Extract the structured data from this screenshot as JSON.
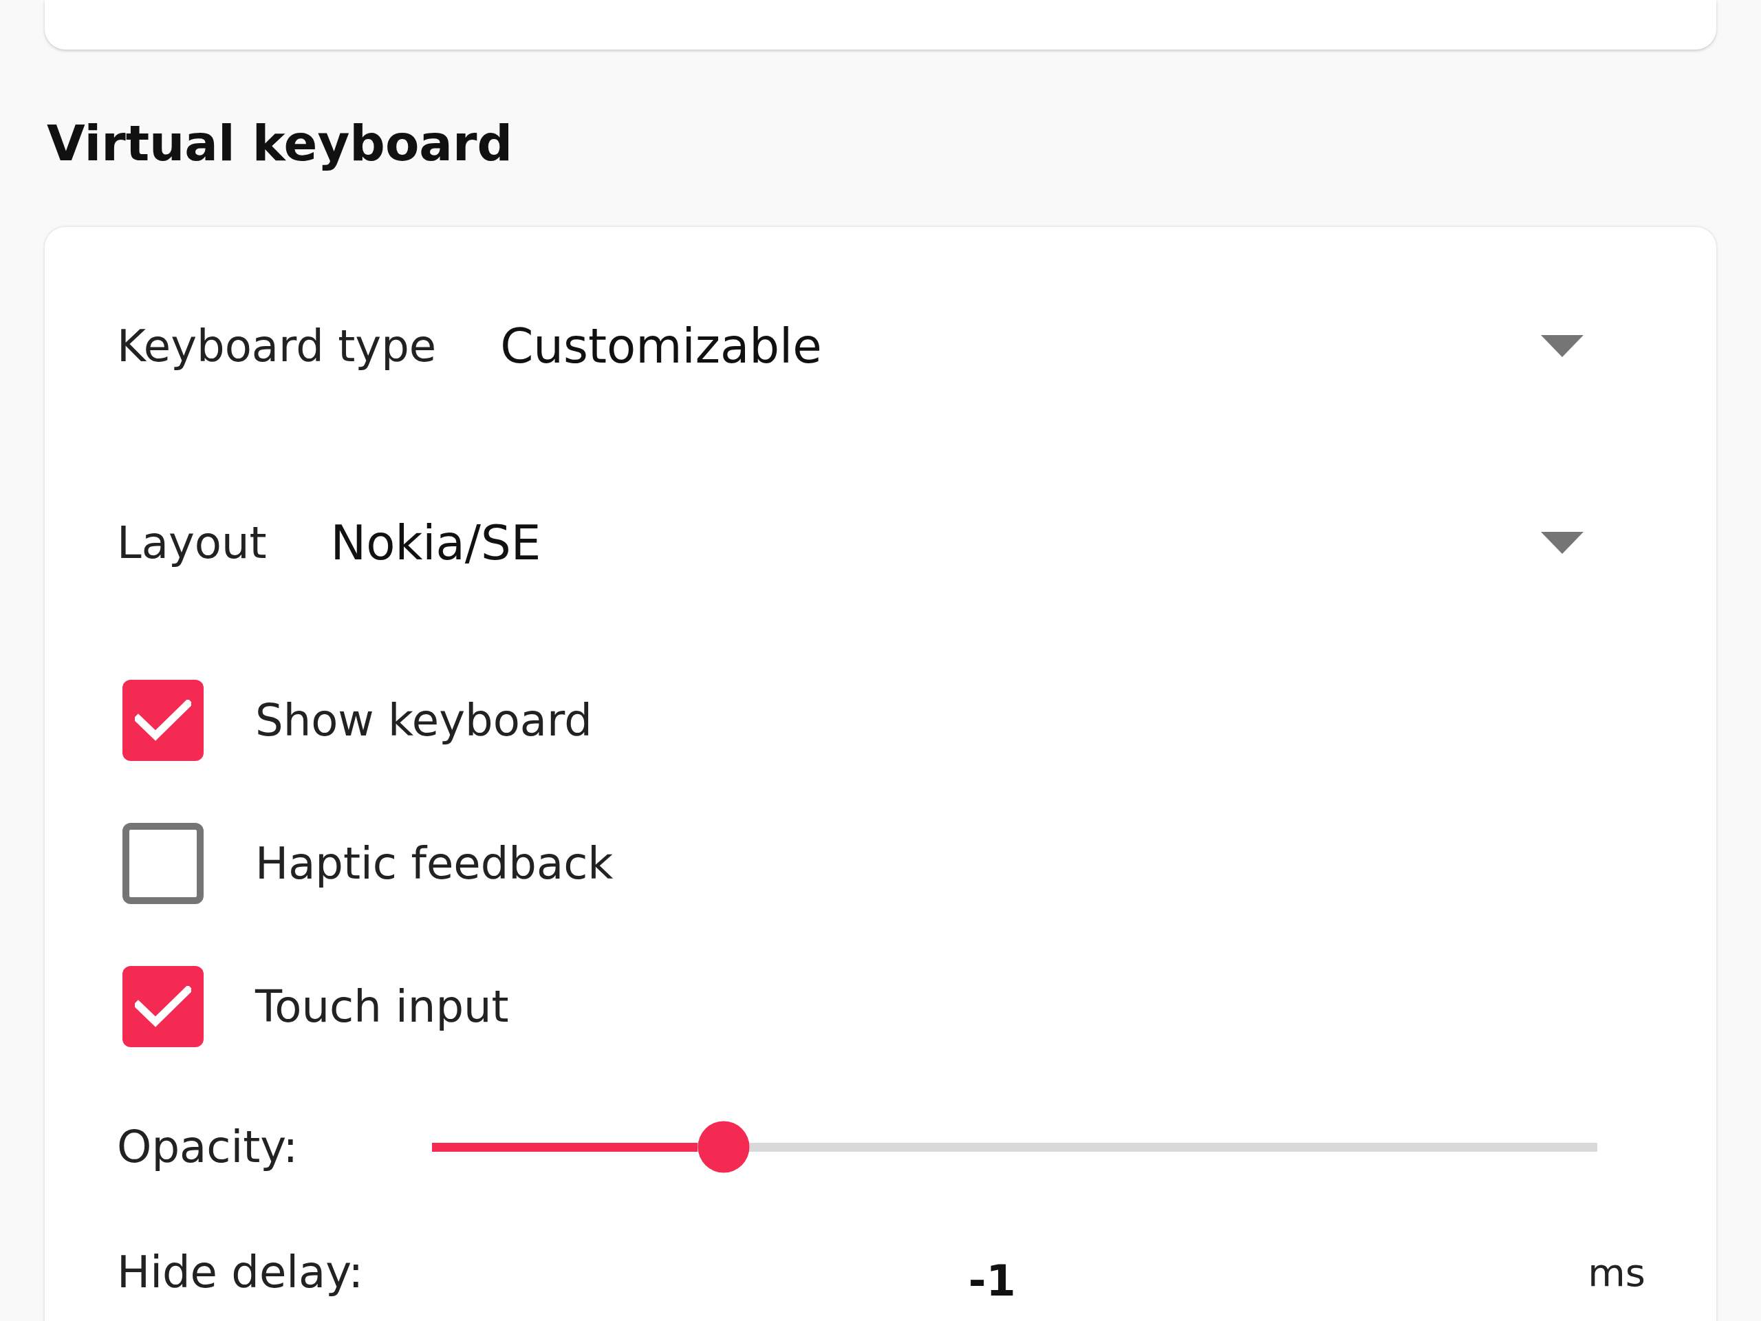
{
  "section": {
    "title": "Virtual keyboard"
  },
  "dropdowns": [
    {
      "label": "Keyboard type",
      "value": "Customizable"
    },
    {
      "label": "Layout",
      "value": "Nokia/SE"
    }
  ],
  "checkboxes": [
    {
      "label": "Show keyboard",
      "checked": true
    },
    {
      "label": "Haptic feedback",
      "checked": false
    },
    {
      "label": "Touch input",
      "checked": true
    }
  ],
  "opacity": {
    "label": "Opacity:",
    "level": 0.25
  },
  "hide_delay": {
    "label": "Hide delay:",
    "value": "-1",
    "unit": "ms"
  }
}
